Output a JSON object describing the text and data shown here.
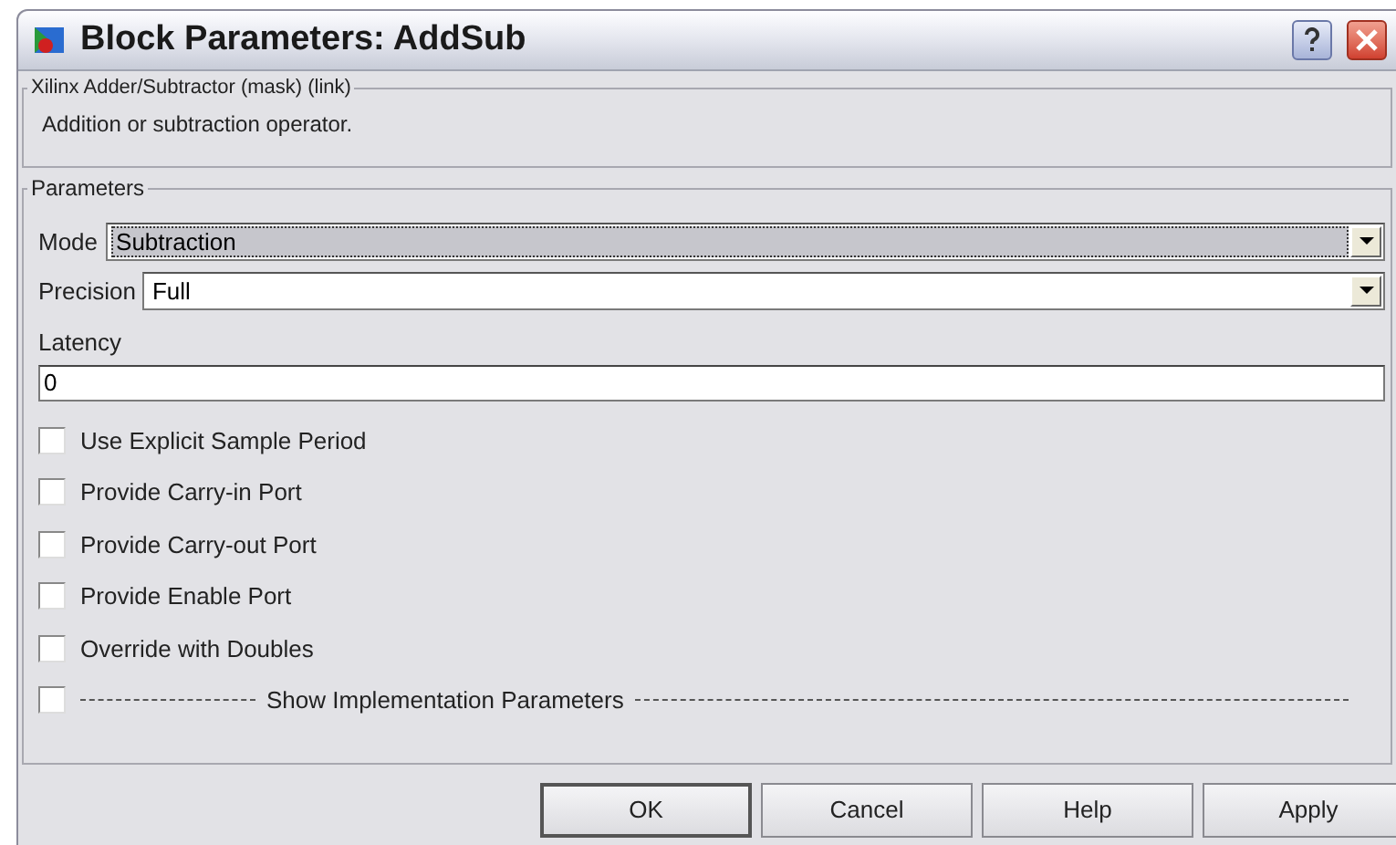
{
  "window": {
    "title": "Block Parameters: AddSub"
  },
  "description_group": {
    "title": "Xilinx Adder/Subtractor (mask) (link)",
    "text": "Addition or subtraction operator."
  },
  "parameters": {
    "title": "Parameters",
    "mode": {
      "label": "Mode",
      "value": "Subtraction",
      "focused": true
    },
    "precision": {
      "label": "Precision",
      "value": "Full",
      "focused": false
    },
    "latency": {
      "label": "Latency",
      "value": "0"
    },
    "options": [
      {
        "label": "Use Explicit Sample Period",
        "checked": false,
        "kind": "plain"
      },
      {
        "label": "Provide Carry-in Port",
        "checked": false,
        "kind": "plain"
      },
      {
        "label": "Provide Carry-out Port",
        "checked": false,
        "kind": "plain"
      },
      {
        "label": "Provide Enable Port",
        "checked": false,
        "kind": "plain"
      },
      {
        "label": "Override with Doubles",
        "checked": false,
        "kind": "plain"
      },
      {
        "label": "Show Implementation Parameters",
        "checked": false,
        "kind": "section"
      }
    ]
  },
  "buttons": [
    "OK",
    "Cancel",
    "Help",
    "Apply"
  ]
}
